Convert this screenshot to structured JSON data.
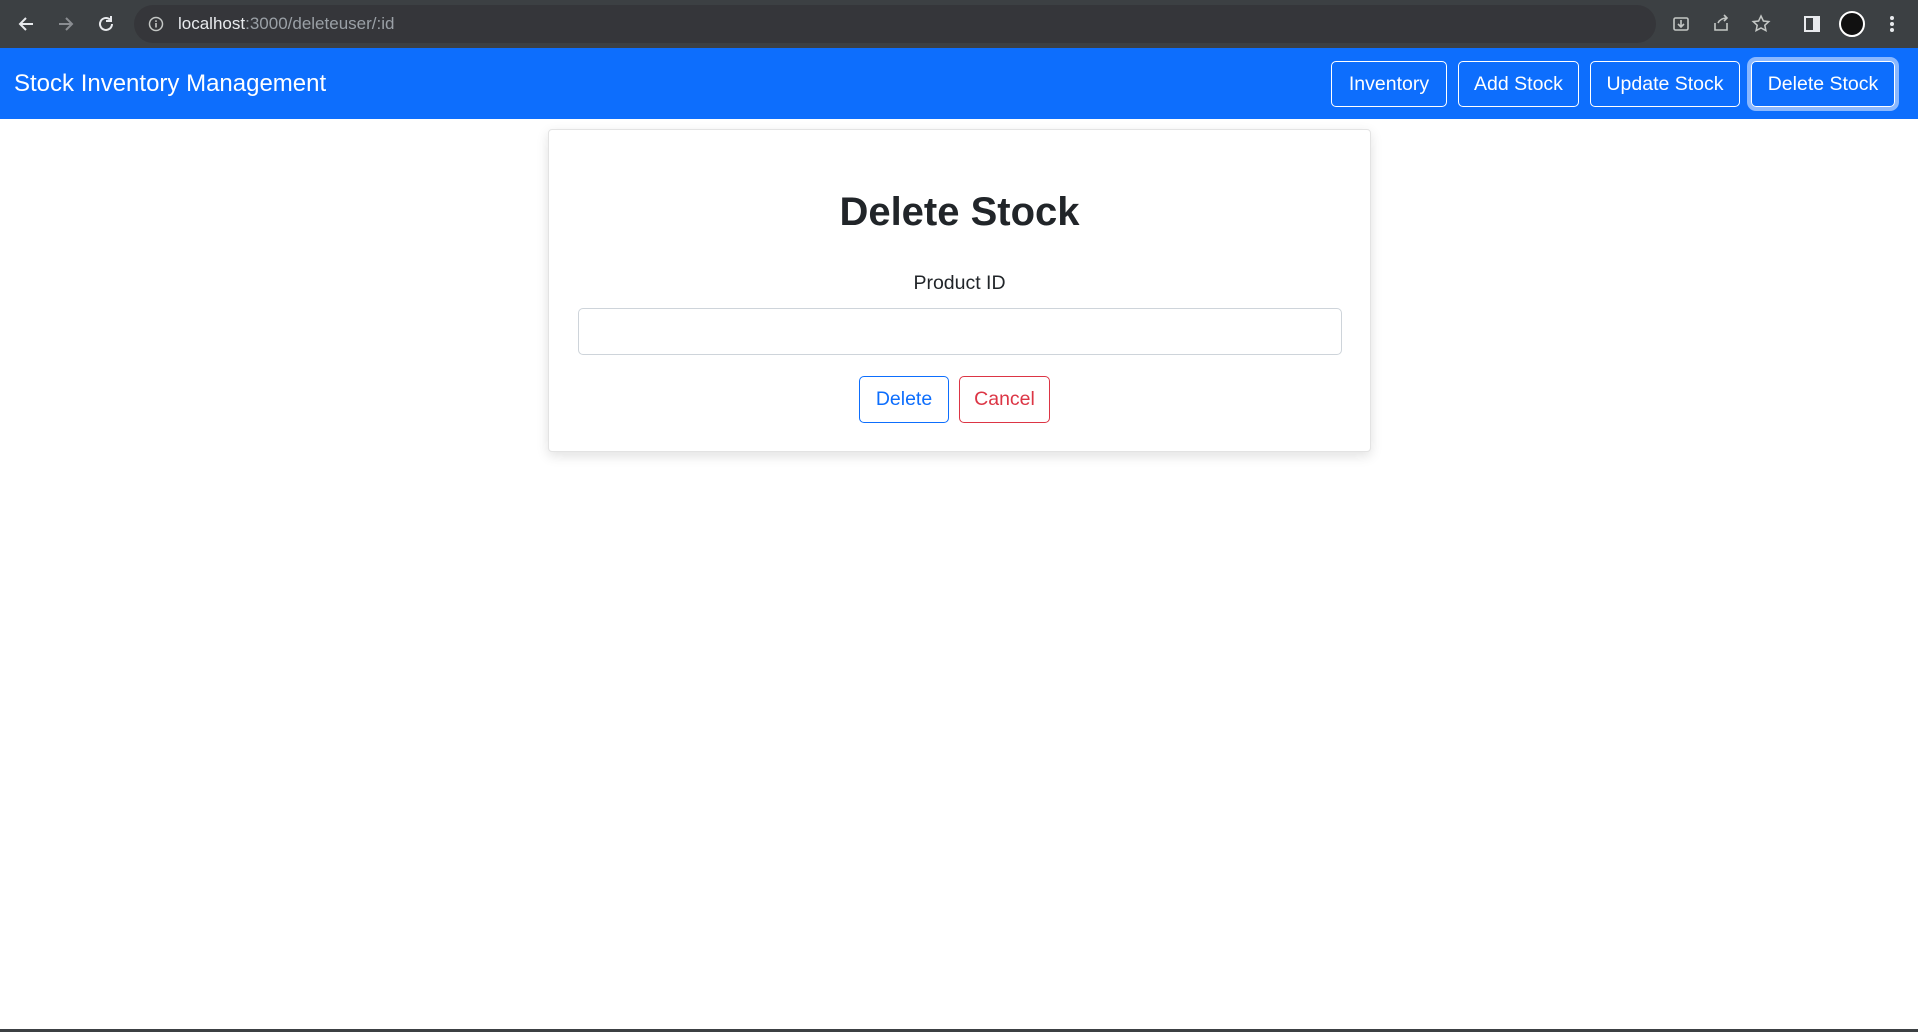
{
  "browser": {
    "url_host": "localhost",
    "url_rest": ":3000/deleteuser/:id"
  },
  "navbar": {
    "brand": "Stock Inventory Management",
    "buttons": {
      "inventory": "Inventory",
      "add_stock": "Add Stock",
      "update_stock": "Update Stock",
      "delete_stock": "Delete Stock"
    }
  },
  "form": {
    "title": "Delete Stock",
    "product_id_label": "Product ID",
    "product_id_value": "",
    "delete_label": "Delete",
    "cancel_label": "Cancel"
  },
  "colors": {
    "navbar": "#0d6efd",
    "delete_button": "#0d6efd",
    "cancel_button": "#dc3545",
    "chrome": "#3c4043"
  }
}
